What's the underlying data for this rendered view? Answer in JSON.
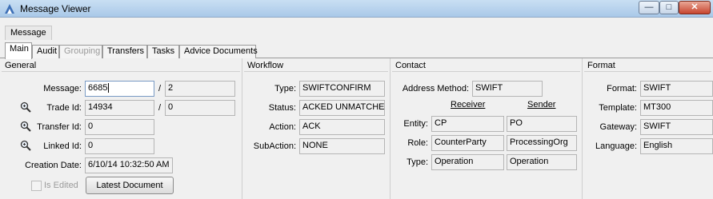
{
  "window": {
    "title": "Message Viewer",
    "buttons": {
      "minimize": "—",
      "maximize": "□",
      "close": "✕"
    }
  },
  "menubar": {
    "items": [
      {
        "label": "Message"
      }
    ]
  },
  "tabs": [
    {
      "label": "Main",
      "active": true
    },
    {
      "label": "Audit"
    },
    {
      "label": "Grouping",
      "disabled": true
    },
    {
      "label": "Transfers"
    },
    {
      "label": "Tasks"
    },
    {
      "label": "Advice Documents"
    }
  ],
  "general": {
    "title": "General",
    "message": {
      "label": "Message:",
      "value": "6685",
      "version": "2"
    },
    "trade_id": {
      "label": "Trade Id:",
      "value": "14934",
      "version": "0"
    },
    "transfer_id": {
      "label": "Transfer Id:",
      "value": "0"
    },
    "linked_id": {
      "label": "Linked Id:",
      "value": "0"
    },
    "creation_date": {
      "label": "Creation Date:",
      "value": "6/10/14 10:32:50 AM"
    },
    "is_edited_label": "Is Edited",
    "is_edited_checked": false,
    "latest_document_label": "Latest Document",
    "slash": "/"
  },
  "workflow": {
    "title": "Workflow",
    "type": {
      "label": "Type:",
      "value": "SWIFTCONFIRM"
    },
    "status": {
      "label": "Status:",
      "value": "ACKED UNMATCHED"
    },
    "action": {
      "label": "Action:",
      "value": "ACK"
    },
    "subaction": {
      "label": "SubAction:",
      "value": "NONE"
    }
  },
  "contact": {
    "title": "Contact",
    "address_method": {
      "label": "Address Method:",
      "value": "SWIFT"
    },
    "receiver_header": "Receiver",
    "sender_header": "Sender",
    "entity": {
      "label": "Entity:",
      "receiver": "CP",
      "sender": "PO"
    },
    "role": {
      "label": "Role:",
      "receiver": "CounterParty",
      "sender": "ProcessingOrg"
    },
    "type": {
      "label": "Type:",
      "receiver": "Operation",
      "sender": "Operation"
    }
  },
  "format": {
    "title": "Format",
    "format": {
      "label": "Format:",
      "value": "SWIFT"
    },
    "template": {
      "label": "Template:",
      "value": "MT300"
    },
    "gateway": {
      "label": "Gateway:",
      "value": "SWIFT"
    },
    "language": {
      "label": "Language:",
      "value": "English"
    }
  },
  "icons": {
    "app": "app-logo-icon",
    "lookup": "magnifier-icon"
  },
  "colors": {
    "titlebar": "#b8d3ee",
    "panel": "#f0f0f0",
    "close_button": "#c7452f",
    "field_border_active": "#7a9bc4"
  }
}
